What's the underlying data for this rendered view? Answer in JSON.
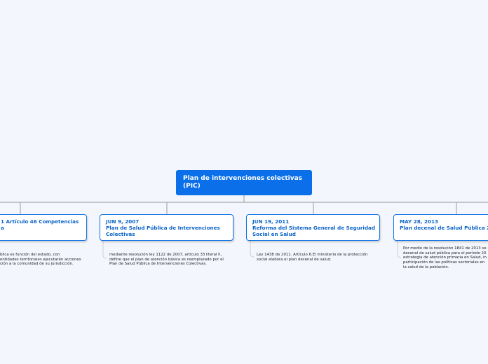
{
  "central": {
    "title_line1": "Plan de intervenciones colectivas",
    "title_line2": "(PIC)"
  },
  "topics": [
    {
      "date": "",
      "title_line1": "1 Artículo 46 Competencias",
      "title_line2": "a",
      "note_lines": [
        "blica es función del estado, con",
        "entidades territoriales ejecutarán acciones",
        "ción a la comunidad de su jurisdicción."
      ]
    },
    {
      "date": "JUN 9, 2007",
      "title_line1": "Plan de Salud Pública de Intervenciones",
      "title_line2": "Colectivas",
      "note_lines": [
        "mediante resolución ley 1122 de 2007, artículo 33 literal h,",
        "define que el plan de atención básica es reemplazado por el",
        "Plan de Salud Pública de Intervenciones Colectivas."
      ]
    },
    {
      "date": "JUN 19, 2011",
      "title_line1": "Reforma del Sistema General de Seguridad",
      "title_line2": "Social en Salud",
      "note_lines": [
        "Ley 1438 de 2011. Artículo 6.El ministerio de la protección",
        "social elabora el plan decenal de salud."
      ]
    },
    {
      "date": "MAY 28, 2013",
      "title_line1": "Plan decenal de Salud Pública 20",
      "title_line2": "",
      "note_lines": [
        "Por medio de la resolución 1841 de 2013 se",
        "decenal de salud pública para el período 20",
        "estrategia de atención primaria en Salud, in",
        "participación de las políticas sectoriales en",
        "la salud de la población."
      ]
    }
  ]
}
